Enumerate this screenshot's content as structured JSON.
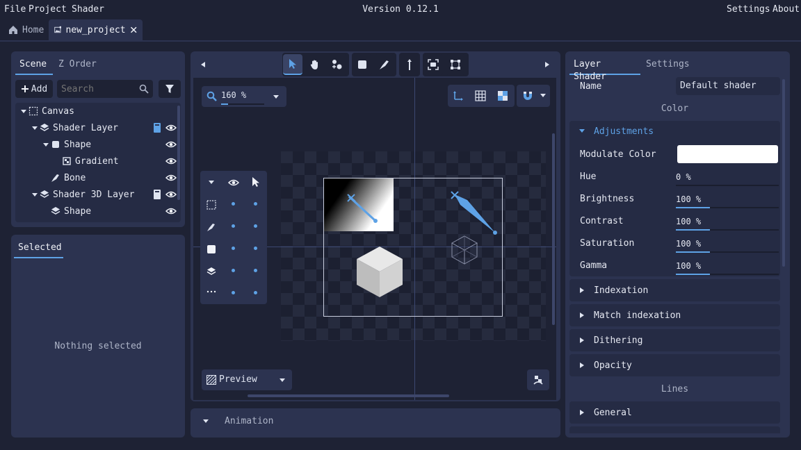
{
  "menu": {
    "file": "File",
    "project": "Project",
    "shader": "Shader",
    "settings": "Settings",
    "about": "About"
  },
  "version": "Version 0.12.1",
  "tabs": {
    "home": "Home",
    "project": "new_project"
  },
  "scene_panel": {
    "tab_scene": "Scene",
    "tab_zorder": "Z Order",
    "add_label": "Add",
    "search_placeholder": "Search",
    "tree": [
      {
        "label": "Canvas"
      },
      {
        "label": "Shader Layer"
      },
      {
        "label": "Shape"
      },
      {
        "label": "Gradient"
      },
      {
        "label": "Bone"
      },
      {
        "label": "Shader 3D Layer"
      },
      {
        "label": "Shape"
      }
    ]
  },
  "selected_panel": {
    "tab": "Selected",
    "empty": "Nothing selected"
  },
  "viewport": {
    "zoom": "160 %",
    "preview": "Preview"
  },
  "animation": {
    "label": "Animation"
  },
  "right_panel": {
    "tab_layer_shader": "Layer Shader",
    "tab_settings": "Settings",
    "name_label": "Name",
    "name_value": "Default shader",
    "color_header": "Color",
    "adjustments": "Adjustments",
    "props": [
      {
        "label": "Modulate Color",
        "value": ""
      },
      {
        "label": "Hue",
        "value": "0 %",
        "fill": 0
      },
      {
        "label": "Brightness",
        "value": "100 %",
        "fill": 0.33
      },
      {
        "label": "Contrast",
        "value": "100 %",
        "fill": 0.33
      },
      {
        "label": "Saturation",
        "value": "100 %",
        "fill": 0.33
      },
      {
        "label": "Gamma",
        "value": "100 %",
        "fill": 0.33
      }
    ],
    "sections": [
      "Indexation",
      "Match indexation",
      "Dithering",
      "Opacity"
    ],
    "lines_header": "Lines",
    "lines_sections": [
      "General"
    ]
  },
  "colors": {
    "accent": "#5ea2e6",
    "panel": "#2c3350",
    "background": "#1e2234"
  }
}
